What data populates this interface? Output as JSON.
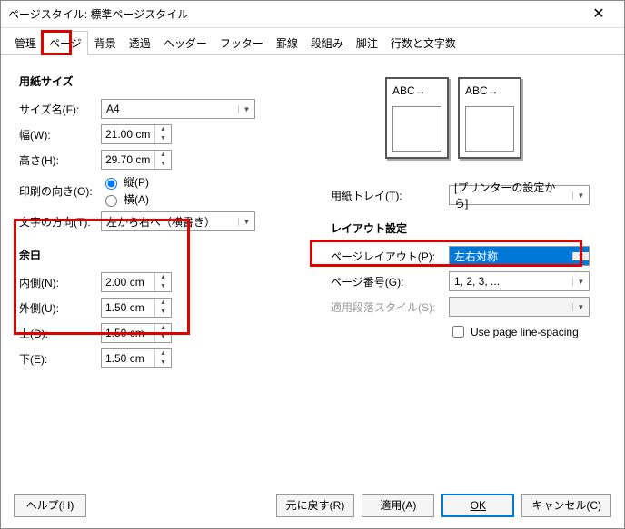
{
  "title": "ページスタイル: 標準ページスタイル",
  "tabs": [
    "管理",
    "ページ",
    "背景",
    "透過",
    "ヘッダー",
    "フッター",
    "罫線",
    "段組み",
    "脚注",
    "行数と文字数"
  ],
  "paper": {
    "heading": "用紙サイズ",
    "size_label": "サイズ名(F):",
    "size_value": "A4",
    "width_label": "幅(W):",
    "width_value": "21.00 cm",
    "height_label": "高さ(H):",
    "height_value": "29.70 cm",
    "orient_label": "印刷の向き(O):",
    "portrait": "縦(P)",
    "landscape": "横(A)",
    "textdir_label": "文字の方向(T):",
    "textdir_value": "左から右へ（横書き）",
    "tray_label": "用紙トレイ(T):",
    "tray_value": "[プリンターの設定から]",
    "prev": "ABC→"
  },
  "margins": {
    "heading": "余白",
    "inner_label": "内側(N):",
    "inner": "2.00 cm",
    "outer_label": "外側(U):",
    "outer": "1.50 cm",
    "top_label": "上(D):",
    "top": "1.50 cm",
    "bottom_label": "下(E):",
    "bottom": "1.50 cm"
  },
  "layout": {
    "heading": "レイアウト設定",
    "page_layout_label": "ページレイアウト(P):",
    "page_layout_value": "左右対称",
    "page_num_label": "ページ番号(G):",
    "page_num_value": "1, 2, 3, ...",
    "para_style_label": "適用段落スタイル(S):",
    "line_spacing": "Use page line-spacing"
  },
  "footer": {
    "help": "ヘルプ(H)",
    "reset": "元に戻す(R)",
    "apply": "適用(A)",
    "ok": "OK",
    "cancel": "キャンセル(C)"
  }
}
